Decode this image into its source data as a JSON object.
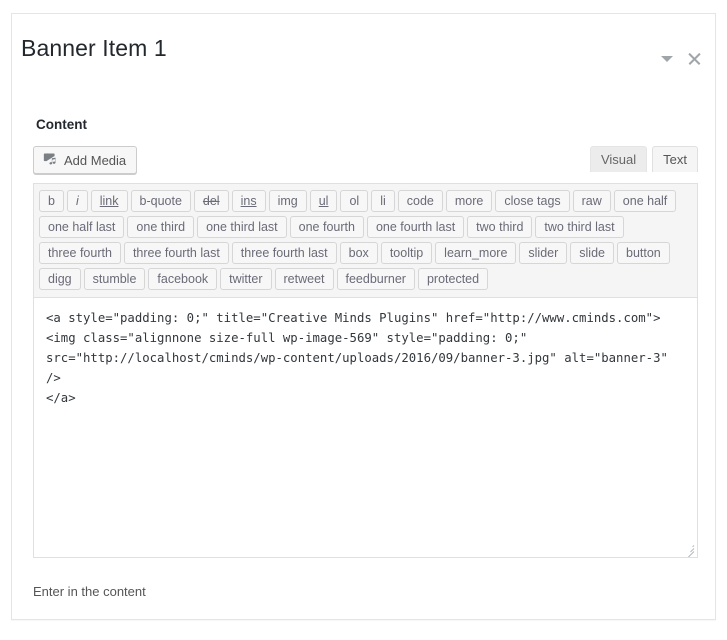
{
  "panel": {
    "title": "Banner Item 1",
    "toggle_icon": "chevron-down-icon",
    "close_icon": "close-icon"
  },
  "field": {
    "label": "Content",
    "help_text": "Enter in the content"
  },
  "media": {
    "add_media_label": "Add Media",
    "icon": "insert-media-icon"
  },
  "editor_tabs": [
    {
      "label": "Visual",
      "active": false
    },
    {
      "label": "Text",
      "active": true
    }
  ],
  "quicktags": {
    "rows": [
      [
        {
          "label": "b",
          "style": "b"
        },
        {
          "label": "i",
          "style": "i"
        },
        {
          "label": "link",
          "style": "u"
        },
        {
          "label": "b-quote",
          "style": ""
        },
        {
          "label": "del",
          "style": "s"
        },
        {
          "label": "ins",
          "style": "u"
        },
        {
          "label": "img",
          "style": ""
        },
        {
          "label": "ul",
          "style": "u"
        },
        {
          "label": "ol",
          "style": ""
        },
        {
          "label": "li",
          "style": ""
        },
        {
          "label": "code",
          "style": ""
        },
        {
          "label": "more",
          "style": ""
        },
        {
          "label": "close tags",
          "style": ""
        },
        {
          "label": "raw",
          "style": ""
        },
        {
          "label": "one half",
          "style": ""
        }
      ],
      [
        {
          "label": "one half last",
          "style": ""
        },
        {
          "label": "one third",
          "style": ""
        },
        {
          "label": "one third last",
          "style": ""
        },
        {
          "label": "one fourth",
          "style": ""
        },
        {
          "label": "one fourth last",
          "style": ""
        },
        {
          "label": "two third",
          "style": ""
        },
        {
          "label": "two third last",
          "style": ""
        }
      ],
      [
        {
          "label": "three fourth",
          "style": ""
        },
        {
          "label": "three fourth last",
          "style": ""
        },
        {
          "label": "three fourth last",
          "style": ""
        },
        {
          "label": "box",
          "style": ""
        },
        {
          "label": "tooltip",
          "style": ""
        },
        {
          "label": "learn_more",
          "style": ""
        },
        {
          "label": "slider",
          "style": ""
        },
        {
          "label": "slide",
          "style": ""
        },
        {
          "label": "button",
          "style": ""
        }
      ],
      [
        {
          "label": "digg",
          "style": ""
        },
        {
          "label": "stumble",
          "style": ""
        },
        {
          "label": "facebook",
          "style": ""
        },
        {
          "label": "twitter",
          "style": ""
        },
        {
          "label": "retweet",
          "style": ""
        },
        {
          "label": "feedburner",
          "style": ""
        },
        {
          "label": "protected",
          "style": ""
        }
      ]
    ]
  },
  "editor": {
    "value": "<a style=\"padding: 0;\" title=\"Creative Minds Plugins\" href=\"http://www.cminds.com\"><img class=\"alignnone size-full wp-image-569\" style=\"padding: 0;\" src=\"http://localhost/cminds/wp-content/uploads/2016/09/banner-3.jpg\" alt=\"banner-3\" />\n</a>",
    "resize_handle": "resize-grip-icon"
  },
  "colors": {
    "panel_border": "#e5e5e5",
    "toolbar_bg": "#f5f5f5",
    "button_bg": "#f7f7f7",
    "title_color": "#23282d",
    "icon_color": "#a0a5aa"
  }
}
